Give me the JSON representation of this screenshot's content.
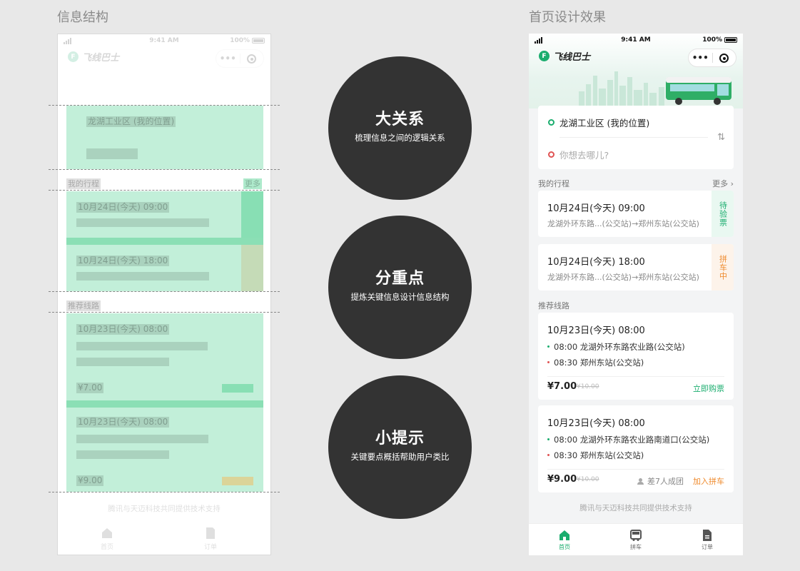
{
  "labels": {
    "wireframe_title": "信息结构",
    "design_title": "首页设计效果"
  },
  "status_bar": {
    "time": "9:41 AM",
    "battery": "100%"
  },
  "app": {
    "name": "飞线巴士",
    "logo_glyph": "F",
    "menu_dots": "•••"
  },
  "search": {
    "from": "龙湖工业区 (我的位置)",
    "to_placeholder": "你想去哪儿?",
    "swap_icon": "⇅"
  },
  "my_trips": {
    "title": "我的行程",
    "more": "更多",
    "items": [
      {
        "time": "10月24日(今天) 09:00",
        "route": "龙湖外环东路...(公交站)→郑州东站(公交站)",
        "status": "待验票"
      },
      {
        "time": "10月24日(今天) 18:00",
        "route": "龙湖外环东路...(公交站)→郑州东站(公交站)",
        "status": "拼车中"
      }
    ]
  },
  "recommended": {
    "title": "推荐线路",
    "items": [
      {
        "time": "10月23日(今天) 08:00",
        "stop_from": "08:00  龙湖外环东路农业路(公交站)",
        "stop_to": "08:30  郑州东站(公交站)",
        "price": "¥7.00",
        "old_price": "¥10.00",
        "action": "立即购票"
      },
      {
        "time": "10月23日(今天) 08:00",
        "stop_from": "08:00  龙湖外环东路农业路南道口(公交站)",
        "stop_to": "08:30  郑州东站(公交站)",
        "price": "¥9.00",
        "old_price": "¥10.00",
        "group_hint": "差7人成团",
        "action": "加入拼车"
      }
    ]
  },
  "footer": "腾讯与天迈科技共同提供技术支持",
  "tabs": [
    {
      "label": "首页",
      "icon": "home-icon"
    },
    {
      "label": "拼车",
      "icon": "bus-icon"
    },
    {
      "label": "订单",
      "icon": "document-icon"
    }
  ],
  "principles": [
    {
      "title": "大关系",
      "subtitle": "梳理信息之间的逻辑关系"
    },
    {
      "title": "分重点",
      "subtitle": "提炼关键信息设计信息结构"
    },
    {
      "title": "小提示",
      "subtitle": "关键要点概括帮助用户类比"
    }
  ],
  "colors": {
    "brand": "#1aad6e",
    "accent": "#ef8a2c",
    "alert": "#e05353",
    "bubble": "#333333"
  }
}
